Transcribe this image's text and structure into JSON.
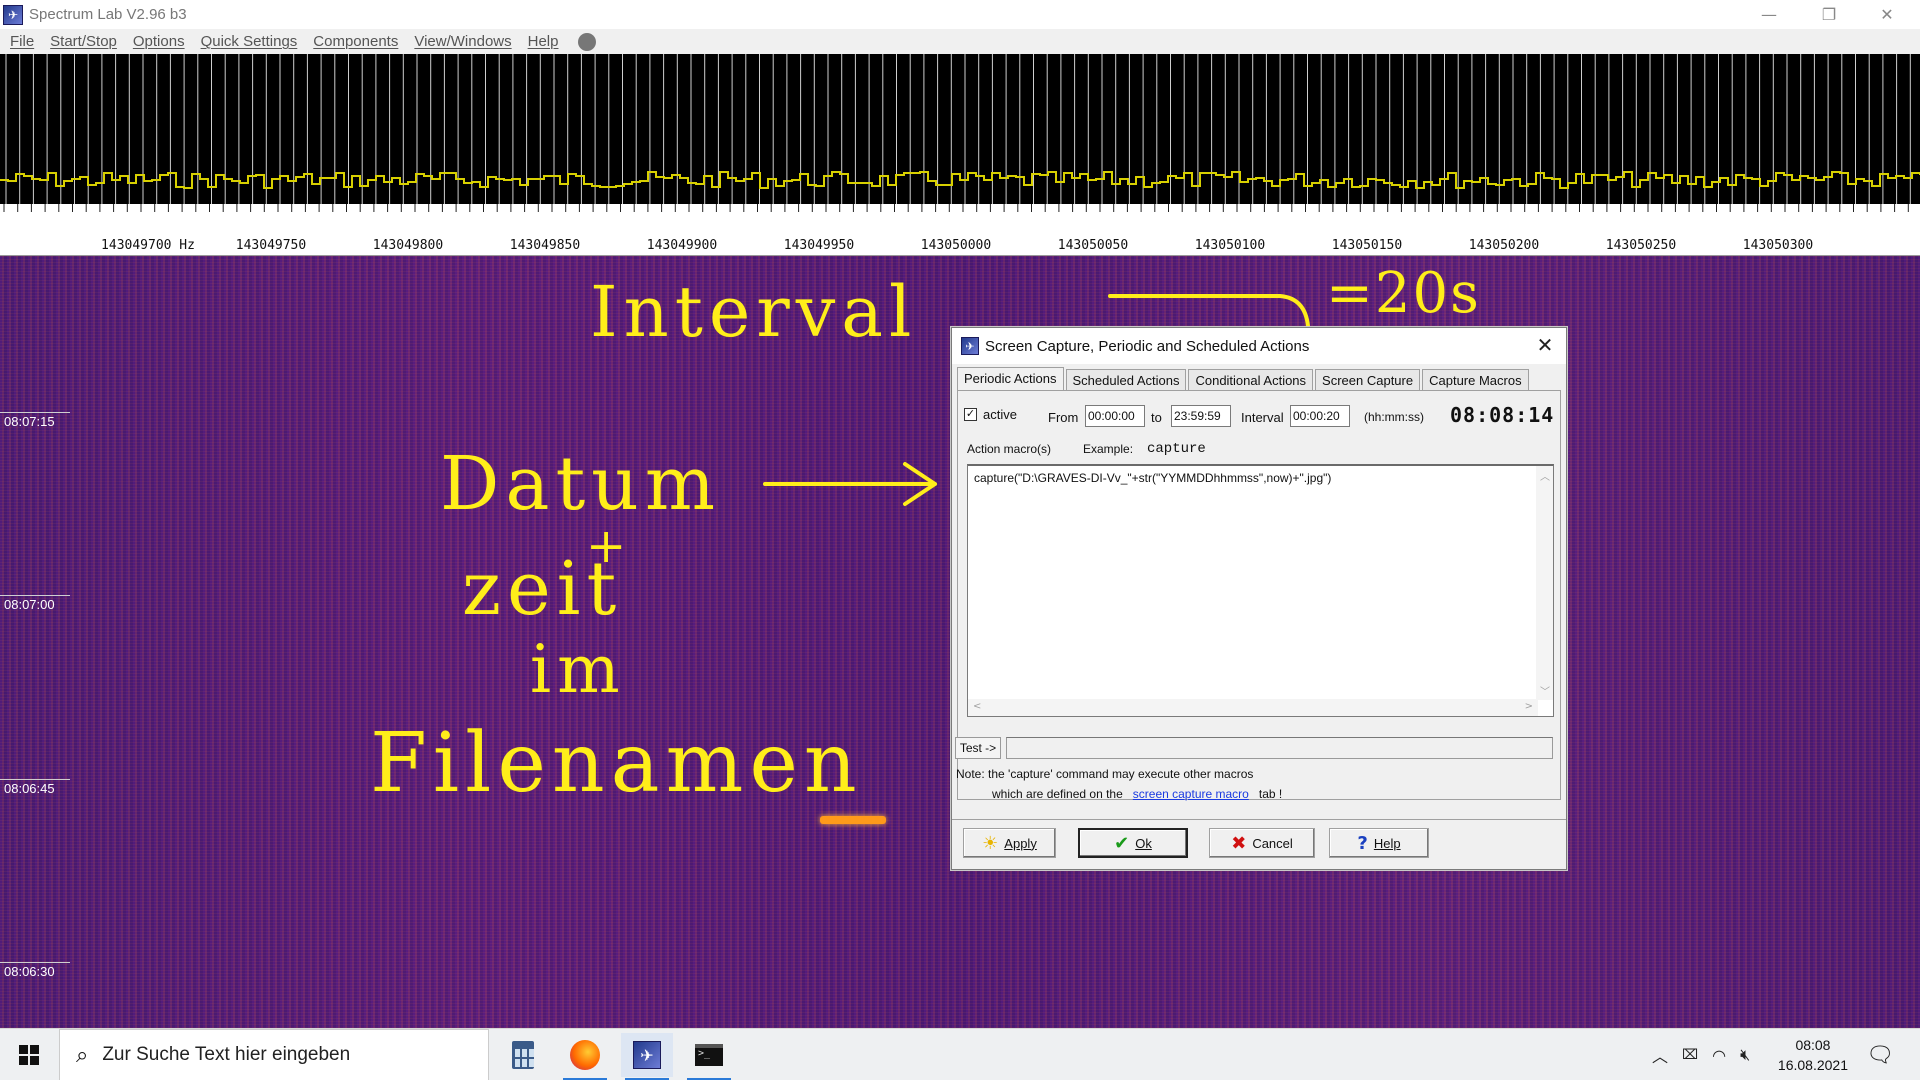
{
  "window": {
    "title": "Spectrum Lab V2.96 b3",
    "minimize_glyph": "—",
    "restore_glyph": "❐",
    "close_glyph": "✕"
  },
  "menu": [
    "File",
    "Start/Stop",
    "Options",
    "Quick Settings",
    "Components",
    "View/Windows",
    "Help"
  ],
  "frequency_axis": {
    "labels": [
      "143049700 Hz",
      "143049750",
      "143049800",
      "143049850",
      "143049900",
      "143049950",
      "143050000",
      "143050050",
      "143050100",
      "143050150",
      "143050200",
      "143050250",
      "143050300"
    ]
  },
  "waterfall": {
    "time_labels": [
      "08:07:15",
      "08:07:00",
      "08:06:45",
      "08:06:30"
    ]
  },
  "annotations": {
    "interval": "Interval",
    "eq20s": "=20s",
    "datum": "Datum",
    "plus": "+",
    "zeit": "zeit",
    "im": "im",
    "filenamen": "Filenamen"
  },
  "dialog": {
    "title": "Screen Capture, Periodic and Scheduled Actions",
    "close_glyph": "✕",
    "tabs": [
      "Periodic Actions",
      "Scheduled Actions",
      "Conditional Actions",
      "Screen Capture",
      "Capture Macros"
    ],
    "active_tab": "Periodic Actions",
    "active_checked": true,
    "active_label": "active",
    "from_label": "From",
    "from_value": "00:00:00",
    "to_label": "to",
    "to_value": "23:59:59",
    "interval_label": "Interval",
    "interval_value": "00:00:20",
    "format_label": "(hh:mm:ss)",
    "clock": "08:08:14",
    "action_macros_label": "Action macro(s)",
    "example_label": "Example:",
    "example_value": "capture",
    "macro_text": "capture(\"D:\\GRAVES-DI-Vv_\"+str(\"YYMMDDhhmmss\",now)+\".jpg\")",
    "test_label": "Test ->",
    "note_line1": "Note: the 'capture' command  may  execute other macros",
    "note_line2_prefix": "which are defined on the",
    "note_link": "screen capture macro",
    "note_line2_suffix": "tab !",
    "buttons": {
      "apply": "Apply",
      "ok": "Ok",
      "cancel": "Cancel",
      "help": "Help"
    }
  },
  "taskbar": {
    "search_placeholder": "Zur Suche Text hier eingeben",
    "time": "08:08",
    "date": "16.08.2021"
  }
}
